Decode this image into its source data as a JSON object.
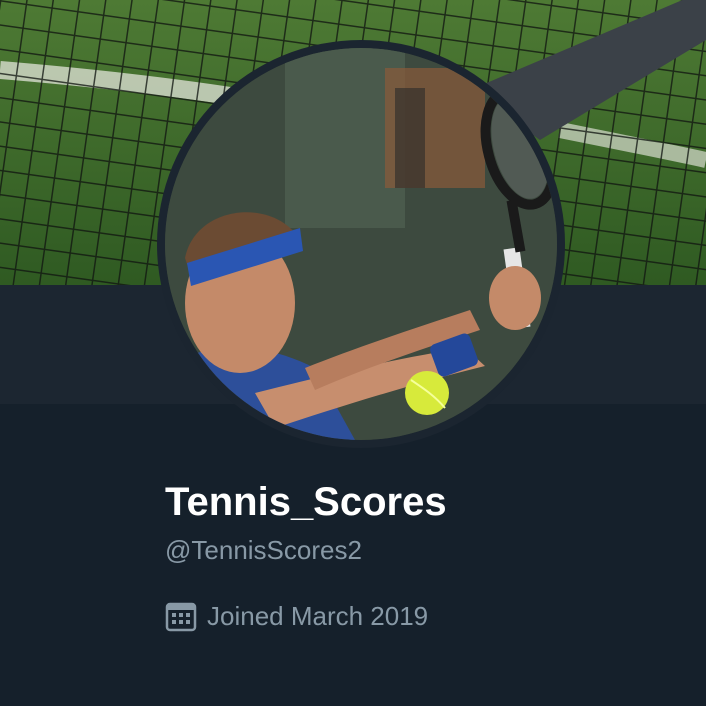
{
  "profile": {
    "display_name": "Tennis_Scores",
    "handle": "@TennisScores2",
    "joined": "Joined March 2019"
  },
  "icons": {
    "joined": "calendar-icon"
  },
  "colors": {
    "background": "#15202b",
    "band": "#1c2631",
    "text_primary": "#ffffff",
    "text_secondary": "#8899a6"
  }
}
